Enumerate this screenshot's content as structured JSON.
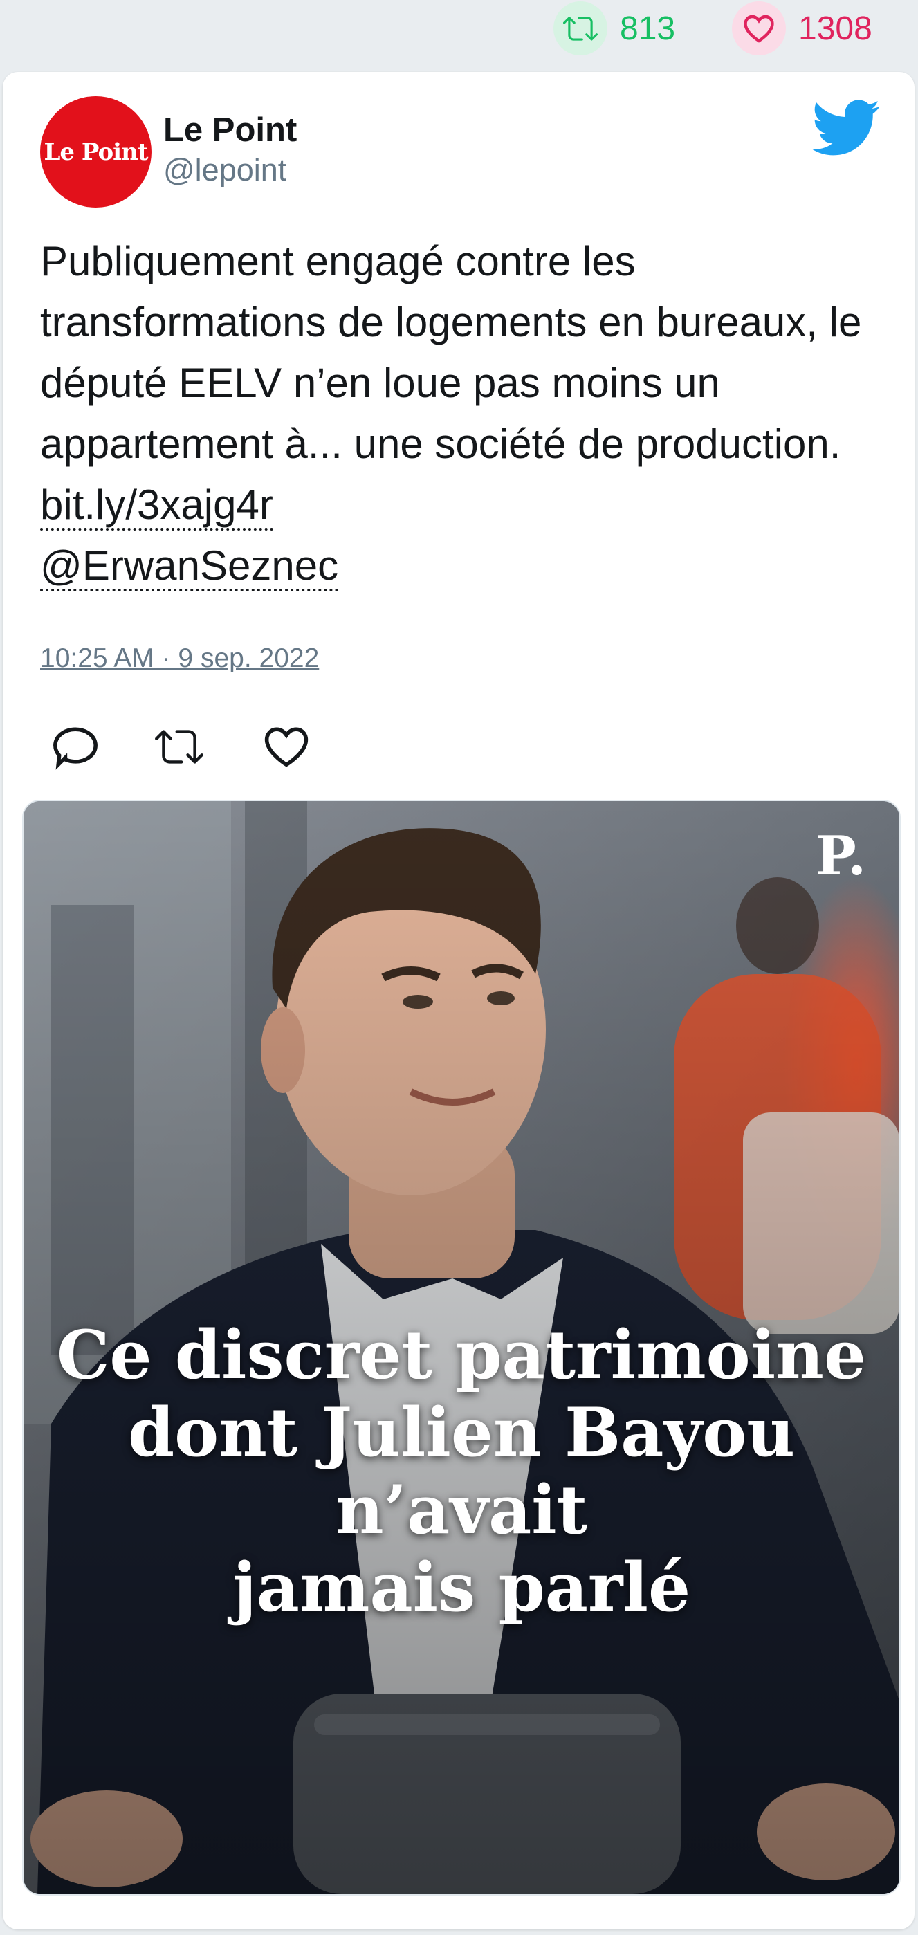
{
  "stats": {
    "retweets": "813",
    "likes": "1308",
    "retweet_icon": "retweet-icon",
    "like_icon": "heart-icon",
    "retweet_color": "#17bf63",
    "like_color": "#e0245e"
  },
  "tweet": {
    "account_name": "Le Point",
    "account_handle": "@lepoint",
    "avatar_text": "Le Point",
    "text_main": "Publiquement engagé contre les transformations de logements en bureaux, le député EELV n’en loue pas moins un appartement à... une société de production.",
    "link": "bit.ly/3xajg4r",
    "mention": "@ErwanSeznec",
    "timestamp": "10:25 AM · 9 sep. 2022",
    "brand_color": "#1da1f2"
  },
  "media": {
    "headline_line1": "Ce discret patrimoine",
    "headline_line2": "dont Julien Bayou n’avait",
    "headline_line3": "jamais parlé",
    "logo_text": "P."
  }
}
